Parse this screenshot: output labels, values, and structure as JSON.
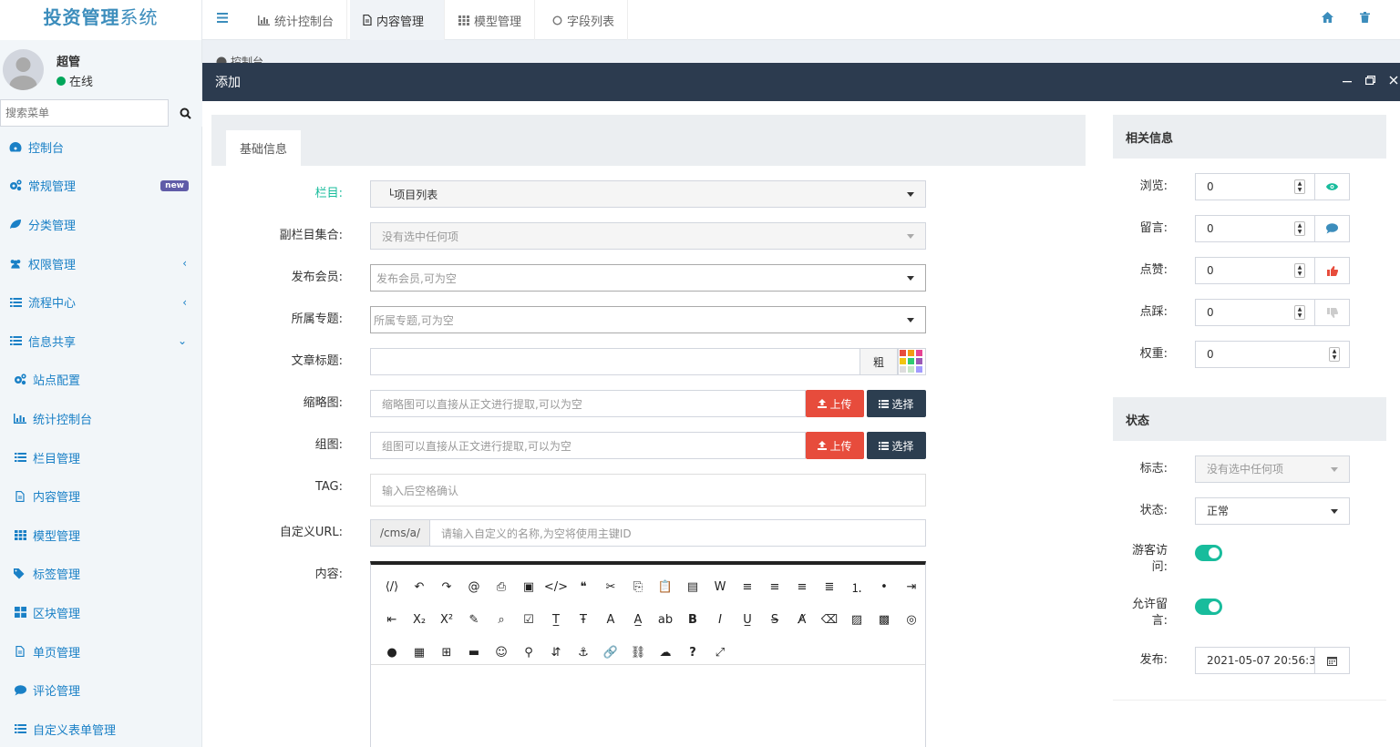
{
  "app": {
    "logo_bold": "投资管理",
    "logo_light": "系统"
  },
  "user": {
    "name": "超管",
    "status": "在线"
  },
  "search": {
    "placeholder": "搜索菜单"
  },
  "menu": [
    {
      "label": "控制台",
      "icon": "dashboard-icon"
    },
    {
      "label": "常规管理",
      "icon": "cogs-icon",
      "badge": "new"
    },
    {
      "label": "分类管理",
      "icon": "leaf-icon"
    },
    {
      "label": "权限管理",
      "icon": "users-icon",
      "arrow": "‹"
    },
    {
      "label": "流程中心",
      "icon": "list-icon",
      "arrow": "‹"
    },
    {
      "label": "信息共享",
      "icon": "list-icon",
      "arrow": "⌄"
    },
    {
      "label": "站点配置",
      "icon": "cogs-icon"
    },
    {
      "label": "统计控制台",
      "icon": "bar-chart-icon"
    },
    {
      "label": "栏目管理",
      "icon": "list-icon"
    },
    {
      "label": "内容管理",
      "icon": "file-icon"
    },
    {
      "label": "模型管理",
      "icon": "th-icon"
    },
    {
      "label": "标签管理",
      "icon": "tags-icon"
    },
    {
      "label": "区块管理",
      "icon": "th-large-icon"
    },
    {
      "label": "单页管理",
      "icon": "file-icon"
    },
    {
      "label": "评论管理",
      "icon": "comment-icon"
    },
    {
      "label": "自定义表单管理",
      "icon": "list-icon"
    }
  ],
  "topbar": {
    "tabs": [
      {
        "label": "统计控制台",
        "icon": "bar-chart-icon"
      },
      {
        "label": "内容管理",
        "icon": "file-icon",
        "active": true
      },
      {
        "label": "模型管理",
        "icon": "th-icon"
      },
      {
        "label": "字段列表",
        "icon": "circle-icon"
      }
    ]
  },
  "breadcrumb": {
    "text": "控制台"
  },
  "dialog": {
    "title": "添加"
  },
  "form": {
    "tab": "基础信息",
    "category": {
      "label": "栏目:",
      "value": "└项目列表"
    },
    "subcategory": {
      "label": "副栏目集合:",
      "placeholder": "没有选中任何项"
    },
    "member": {
      "label": "发布会员:",
      "placeholder": "发布会员,可为空"
    },
    "topic": {
      "label": "所属专题:",
      "placeholder": "所属专题,可为空"
    },
    "title": {
      "label": "文章标题:",
      "bold": "粗"
    },
    "thumb": {
      "label": "缩略图:",
      "placeholder": "缩略图可以直接从正文进行提取,可以为空",
      "upload": "上传",
      "select": "选择"
    },
    "gallery": {
      "label": "组图:",
      "placeholder": "组图可以直接从正文进行提取,可以为空",
      "upload": "上传",
      "select": "选择"
    },
    "tag": {
      "label": "TAG:",
      "placeholder": "输入后空格确认"
    },
    "url": {
      "label": "自定义URL:",
      "prefix": "/cms/a/",
      "placeholder": "请输入自定义的名称,为空将使用主键ID"
    },
    "content": {
      "label": "内容:"
    }
  },
  "editor_toolbar": [
    "source",
    "undo",
    "redo",
    "at",
    "print",
    "preview",
    "code",
    "quote",
    "cut",
    "copy",
    "paste-text",
    "paste",
    "paste-word",
    "align-left",
    "align-center",
    "align-right",
    "justify",
    "ordered-list",
    "unordered-list",
    "indent",
    "outdent",
    "subscript",
    "superscript",
    "format",
    "search-replace",
    "select-all",
    "title",
    "font",
    "font-size",
    "font-color",
    "highlight",
    "bold",
    "italic",
    "underline",
    "strikethrough",
    "clear-format",
    "eraser",
    "image",
    "multi-image",
    "flash",
    "media",
    "insert-file",
    "table",
    "hr",
    "emoticon",
    "baidumap",
    "pagebreak",
    "anchor",
    "link",
    "unlink",
    "template",
    "help",
    "fullscreen"
  ],
  "related": {
    "title": "相关信息",
    "fields": [
      {
        "label": "浏览:",
        "value": "0",
        "icon": "eye-icon",
        "color": "#18bc9c"
      },
      {
        "label": "留言:",
        "value": "0",
        "icon": "comment-icon",
        "color": "#3c8dbc"
      },
      {
        "label": "点赞:",
        "value": "0",
        "icon": "thumbs-up-icon",
        "color": "#e74c3c"
      },
      {
        "label": "点踩:",
        "value": "0",
        "icon": "thumbs-down-icon",
        "color": "#ccc"
      },
      {
        "label": "权重:",
        "value": "0"
      }
    ]
  },
  "status": {
    "title": "状态",
    "flag": {
      "label": "标志:",
      "placeholder": "没有选中任何项"
    },
    "state": {
      "label": "状态:",
      "value": "正常"
    },
    "guest": {
      "label_1": "游客访",
      "label_2": "问:",
      "on": true
    },
    "comment": {
      "label_1": "允许留",
      "label_2": "言:",
      "on": true
    },
    "publish": {
      "label": "发布:",
      "value": "2021-05-07 20:56:3"
    }
  },
  "colors": {
    "accent": "#18bc9c",
    "danger": "#e74c3c",
    "dark": "#2c3e50",
    "link": "#1a80c6",
    "header": "#2c3b4f"
  }
}
